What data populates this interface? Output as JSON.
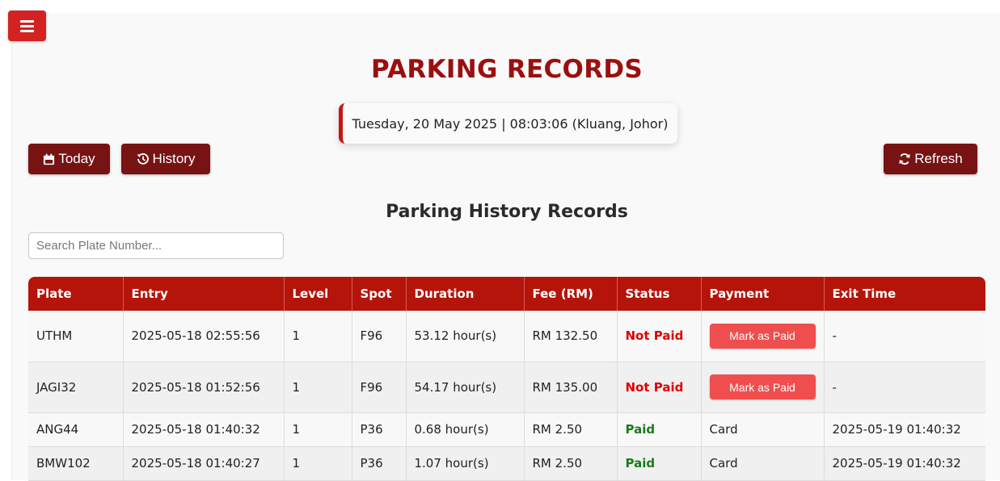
{
  "page": {
    "title": "PARKING RECORDS",
    "datetime": "Tuesday, 20 May 2025 | 08:03:06 (Kluang, Johor)",
    "section_title": "Parking History Records"
  },
  "toolbar": {
    "menu_icon": "hamburger-menu-icon",
    "today_label": "Today",
    "today_icon": "calendar-icon",
    "history_label": "History",
    "history_icon": "history-icon",
    "refresh_label": "Refresh",
    "refresh_icon": "refresh-icon"
  },
  "search": {
    "placeholder": "Search Plate Number...",
    "value": ""
  },
  "table": {
    "headers": [
      "Plate",
      "Entry",
      "Level",
      "Spot",
      "Duration",
      "Fee (RM)",
      "Status",
      "Payment",
      "Exit Time"
    ],
    "rows": [
      {
        "plate": "UTHM",
        "entry": "2025-05-18 02:55:56",
        "level": "1",
        "spot": "F96",
        "duration": "53.12 hour(s)",
        "fee": "RM 132.50",
        "status": "Not Paid",
        "payment": "Mark as Paid",
        "exit": "-"
      },
      {
        "plate": "JAGI32",
        "entry": "2025-05-18 01:52:56",
        "level": "1",
        "spot": "F96",
        "duration": "54.17 hour(s)",
        "fee": "RM 135.00",
        "status": "Not Paid",
        "payment": "Mark as Paid",
        "exit": "-"
      },
      {
        "plate": "ANG44",
        "entry": "2025-05-18 01:40:32",
        "level": "1",
        "spot": "P36",
        "duration": "0.68 hour(s)",
        "fee": "RM 2.50",
        "status": "Paid",
        "payment": "Card",
        "exit": "2025-05-19 01:40:32"
      },
      {
        "plate": "BMW102",
        "entry": "2025-05-18 01:40:27",
        "level": "1",
        "spot": "P36",
        "duration": "1.07 hour(s)",
        "fee": "RM 2.50",
        "status": "Paid",
        "payment": "Card",
        "exit": "2025-05-19 01:40:32"
      }
    ]
  },
  "colors": {
    "brand": "#9b0f0f",
    "header_bg": "#b5140b",
    "button_dark": "#771313",
    "menu_button": "#d32222",
    "mark_paid_button": "#f04e4e",
    "not_paid": "#e00000",
    "paid": "#1a7a1a"
  }
}
